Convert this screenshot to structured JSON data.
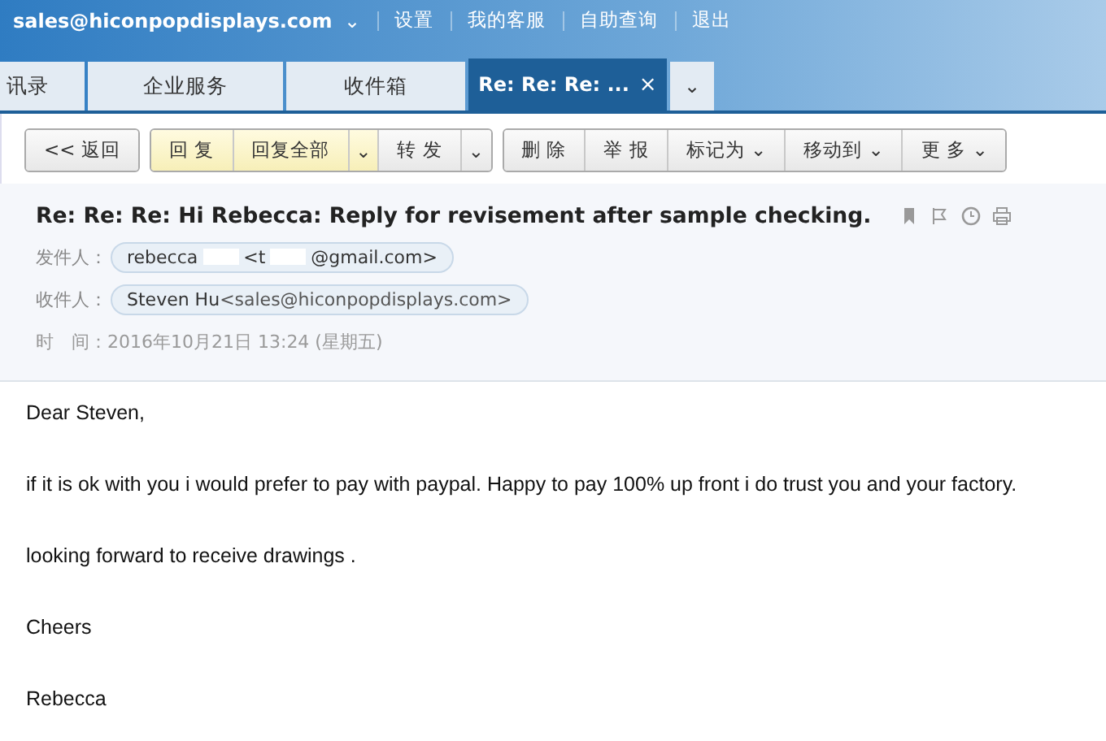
{
  "top_bar": {
    "account": "sales@hiconpopdisplays.com",
    "caret": "⌄",
    "links": [
      "设置",
      "我的客服",
      "自助查询",
      "退出"
    ]
  },
  "tabs": [
    {
      "label": "讯录",
      "selected": false
    },
    {
      "label": "企业服务",
      "selected": false
    },
    {
      "label": "收件箱",
      "selected": false
    },
    {
      "label": "Re: Re: Re: ...",
      "selected": true,
      "close": "×"
    }
  ],
  "tab_menu": "⌄",
  "toolbar": [
    [
      {
        "label": "<< 返回",
        "kind": "plain"
      }
    ],
    [
      {
        "label": "回 复",
        "kind": "highlight"
      },
      {
        "label": "回复全部",
        "kind": "highlight"
      },
      {
        "label": "⌄",
        "kind": "highlight-caret"
      },
      {
        "label": "转 发",
        "kind": "plain"
      },
      {
        "label": "⌄",
        "kind": "caret"
      }
    ],
    [
      {
        "label": "删 除",
        "kind": "plain"
      },
      {
        "label": "举 报",
        "kind": "plain"
      },
      {
        "label": "标记为 ⌄",
        "kind": "plain"
      },
      {
        "label": "移动到 ⌄",
        "kind": "plain"
      },
      {
        "label": "更 多 ⌄",
        "kind": "plain"
      }
    ]
  ],
  "message": {
    "subject": "Re: Re: Re: Hi Rebecca: Reply for revisement after sample checking.",
    "from": {
      "label": "发件人：",
      "name": "rebecca",
      "address_start": "<t",
      "address_end": "@gmail.com>"
    },
    "to": {
      "label": "收件人：",
      "name": "Steven Hu",
      "address": "<sales@hiconpopdisplays.com>"
    },
    "time": {
      "label": "时　间：",
      "value": "2016年10月21日 13:24 (星期五)"
    },
    "body": [
      "Dear Steven,",
      "if it is ok with you i would prefer to pay with paypal. Happy to pay 100% up front i do trust you and your factory.",
      "looking forward to receive drawings .",
      "Cheers",
      "Rebecca"
    ]
  }
}
